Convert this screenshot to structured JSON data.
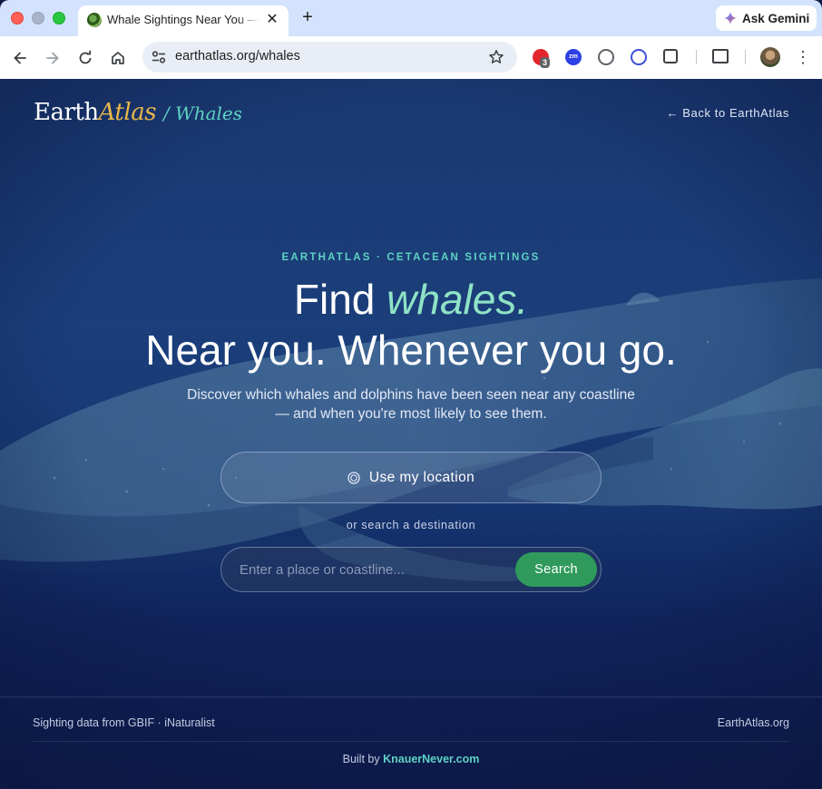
{
  "browser": {
    "tab_title": "Whale Sightings Near You — EarthAtlas",
    "tab_close": "✕",
    "new_tab": "+",
    "url": "earthatlas.org/whales",
    "gemini_label": "Ask Gemini",
    "extension_badge": "3",
    "zoom_ext_label": "zm",
    "menu": "⋮"
  },
  "header": {
    "brand_earth": "Earth",
    "brand_atlas": "Atlas",
    "brand_sub": "/ Whales",
    "back_link": "← Back to EarthAtlas"
  },
  "hero": {
    "eyebrow": "EARTHATLAS · CETACEAN SIGHTINGS",
    "headline_find": "Find ",
    "headline_accent": "whales.",
    "headline_line2": "Near you. Whenever you go.",
    "subtext": "Discover which whales and dolphins have been seen near any coastline — and when you're most likely to see them.",
    "location_button": "Use my location",
    "or_text": "or search a destination",
    "search_placeholder": "Enter a place or coastline...",
    "search_button": "Search"
  },
  "footer": {
    "data_source": "Sighting data from GBIF · iNaturalist",
    "site": "EarthAtlas.org",
    "built_by": "Built by ",
    "built_link": "KnauerNever.com"
  },
  "colors": {
    "accent_teal": "#5ed2c3",
    "accent_gold": "#e8b64a",
    "search_green": "#2f9a5c",
    "page_blue": "#1b3f7b"
  }
}
